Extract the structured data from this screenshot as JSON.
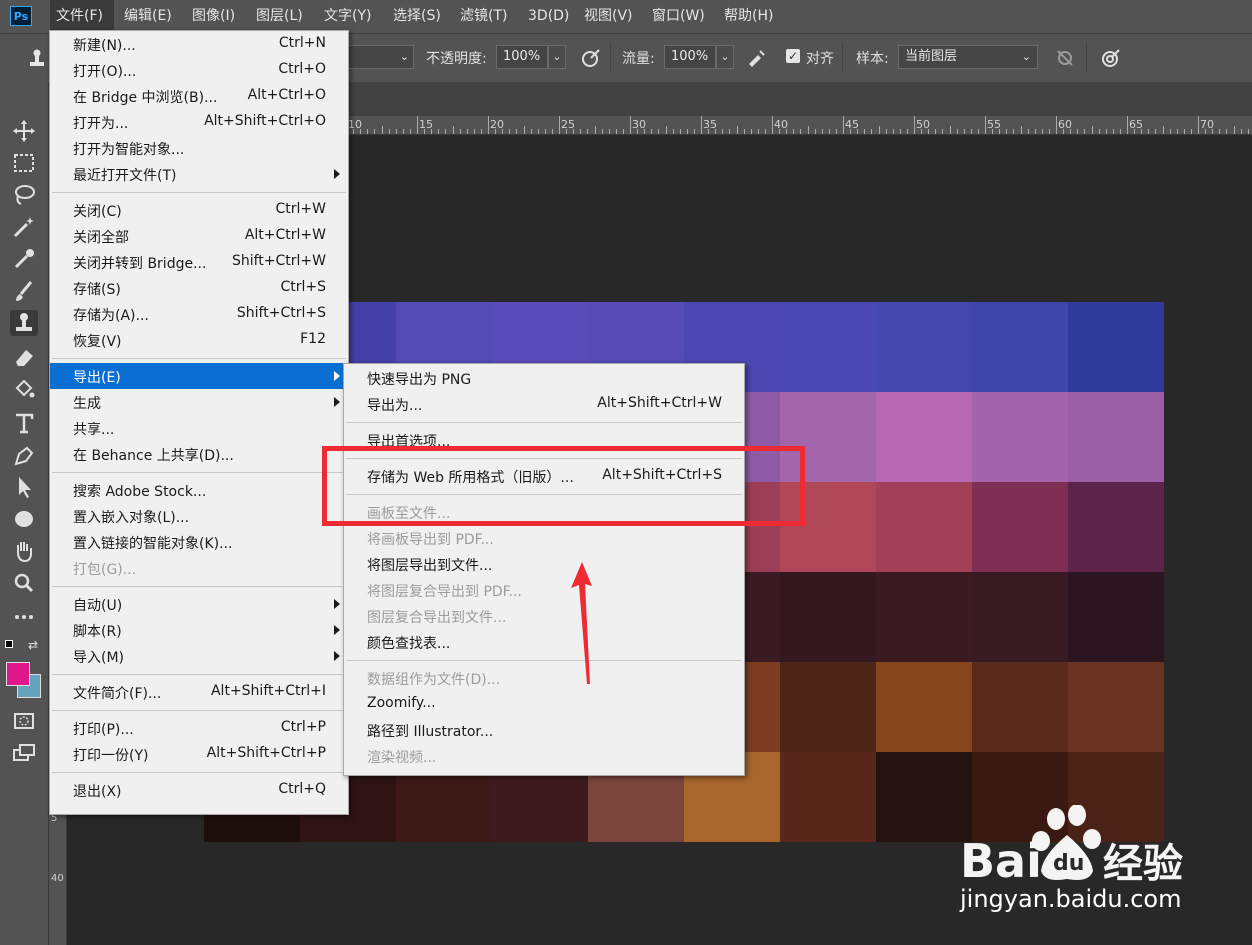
{
  "app": {
    "logo_text": "Ps",
    "menubar": [
      {
        "label": "文件(F)",
        "active": true
      },
      {
        "label": "编辑(E)"
      },
      {
        "label": "图像(I)"
      },
      {
        "label": "图层(L)"
      },
      {
        "label": "文字(Y)"
      },
      {
        "label": "选择(S)"
      },
      {
        "label": "滤镜(T)"
      },
      {
        "label": "3D(D)"
      },
      {
        "label": "视图(V)"
      },
      {
        "label": "窗口(W)"
      },
      {
        "label": "帮助(H)"
      }
    ]
  },
  "options_bar": {
    "opacity_label": "不透明度:",
    "opacity_value": "100%",
    "flow_label": "流量:",
    "flow_value": "100%",
    "align_label": "对齐",
    "align_checked": true,
    "sample_label": "样本:",
    "sample_value": "当前图层"
  },
  "ruler": {
    "top_labels": [
      "10",
      "15",
      "20",
      "25",
      "30",
      "35",
      "40",
      "45",
      "50",
      "55",
      "60",
      "65",
      "70"
    ],
    "left_labels": [
      "5",
      "40"
    ]
  },
  "file_menu": [
    {
      "label": "新建(N)...",
      "shortcut": "Ctrl+N"
    },
    {
      "label": "打开(O)...",
      "shortcut": "Ctrl+O"
    },
    {
      "label": "在 Bridge 中浏览(B)...",
      "shortcut": "Alt+Ctrl+O"
    },
    {
      "label": "打开为...",
      "shortcut": "Alt+Shift+Ctrl+O"
    },
    {
      "label": "打开为智能对象...",
      "shortcut": ""
    },
    {
      "label": "最近打开文件(T)",
      "shortcut": "",
      "submenu": true
    },
    {
      "separator": true
    },
    {
      "label": "关闭(C)",
      "shortcut": "Ctrl+W"
    },
    {
      "label": "关闭全部",
      "shortcut": "Alt+Ctrl+W"
    },
    {
      "label": "关闭并转到 Bridge...",
      "shortcut": "Shift+Ctrl+W"
    },
    {
      "label": "存储(S)",
      "shortcut": "Ctrl+S"
    },
    {
      "label": "存储为(A)...",
      "shortcut": "Shift+Ctrl+S"
    },
    {
      "label": "恢复(V)",
      "shortcut": "F12"
    },
    {
      "separator": true
    },
    {
      "label": "导出(E)",
      "shortcut": "",
      "submenu": true,
      "highlighted": true
    },
    {
      "label": "生成",
      "shortcut": "",
      "submenu": true
    },
    {
      "label": "共享...",
      "shortcut": ""
    },
    {
      "label": "在 Behance 上共享(D)...",
      "shortcut": ""
    },
    {
      "separator": true
    },
    {
      "label": "搜索 Adobe Stock...",
      "shortcut": ""
    },
    {
      "label": "置入嵌入对象(L)...",
      "shortcut": ""
    },
    {
      "label": "置入链接的智能对象(K)...",
      "shortcut": ""
    },
    {
      "label": "打包(G)...",
      "shortcut": "",
      "disabled": true
    },
    {
      "separator": true
    },
    {
      "label": "自动(U)",
      "shortcut": "",
      "submenu": true
    },
    {
      "label": "脚本(R)",
      "shortcut": "",
      "submenu": true
    },
    {
      "label": "导入(M)",
      "shortcut": "",
      "submenu": true
    },
    {
      "separator": true
    },
    {
      "label": "文件简介(F)...",
      "shortcut": "Alt+Shift+Ctrl+I"
    },
    {
      "separator": true
    },
    {
      "label": "打印(P)...",
      "shortcut": "Ctrl+P"
    },
    {
      "label": "打印一份(Y)",
      "shortcut": "Alt+Shift+Ctrl+P"
    },
    {
      "separator": true
    },
    {
      "label": "退出(X)",
      "shortcut": "Ctrl+Q"
    }
  ],
  "export_submenu": [
    {
      "label": "快速导出为 PNG",
      "shortcut": ""
    },
    {
      "label": "导出为...",
      "shortcut": "Alt+Shift+Ctrl+W"
    },
    {
      "separator": true
    },
    {
      "label": "导出首选项...",
      "shortcut": ""
    },
    {
      "separator": true
    },
    {
      "label": "存储为 Web 所用格式（旧版）...",
      "shortcut": "Alt+Shift+Ctrl+S"
    },
    {
      "separator": true
    },
    {
      "label": "画板至文件...",
      "shortcut": "",
      "disabled": true
    },
    {
      "label": "将画板导出到 PDF...",
      "shortcut": "",
      "disabled": true
    },
    {
      "label": "将图层导出到文件...",
      "shortcut": ""
    },
    {
      "label": "将图层复合导出到 PDF...",
      "shortcut": "",
      "disabled": true
    },
    {
      "label": "图层复合导出到文件...",
      "shortcut": "",
      "disabled": true
    },
    {
      "label": "颜色查找表...",
      "shortcut": ""
    },
    {
      "separator": true
    },
    {
      "label": "数据组作为文件(D)...",
      "shortcut": "",
      "disabled": true
    },
    {
      "label": "Zoomify...",
      "shortcut": ""
    },
    {
      "label": "路径到 Illustrator...",
      "shortcut": ""
    },
    {
      "label": "渲染视频...",
      "shortcut": "",
      "disabled": true
    }
  ],
  "canvas": {
    "cols": 10,
    "rows": 6,
    "colors": [
      [
        "#3f3a9e",
        "#4540a8",
        "#5549b4",
        "#5a4cb8",
        "#574ab4",
        "#4d47b1",
        "#4b48b4",
        "#4447ac",
        "#3f46a9",
        "#2f3b9a"
      ],
      [
        "#5a4ba8",
        "#6a52a8",
        "#7e56a8",
        "#8a5aaa",
        "#8b5aa8",
        "#8d5aa4",
        "#a466aa",
        "#b76ab3",
        "#a464ac",
        "#9a5fa5"
      ],
      [
        "#5b3262",
        "#7a3b66",
        "#8b3d60",
        "#8a3a58",
        "#8c3a56",
        "#9c3e58",
        "#b04759",
        "#a24058",
        "#7e2f53",
        "#5b2448"
      ],
      [
        "#2d1a24",
        "#3a1c26",
        "#442029",
        "#3e1d26",
        "#3c1c25",
        "#3a1b24",
        "#34181f",
        "#3a1b24",
        "#381a22",
        "#2a1520"
      ],
      [
        "#3a1f16",
        "#57281a",
        "#6f3420",
        "#6b321f",
        "#6d3420",
        "#7d3c22",
        "#4c2418",
        "#85461e",
        "#5a2a1a",
        "#6a3422"
      ],
      [
        "#1e0e0c",
        "#2e1412",
        "#3d1a17",
        "#3d1a1d",
        "#7a463c",
        "#a8662c",
        "#59281a",
        "#241210",
        "#3a1912",
        "#4a2216"
      ]
    ]
  },
  "watermark": {
    "url_text": "jingyan.baidu.com"
  }
}
